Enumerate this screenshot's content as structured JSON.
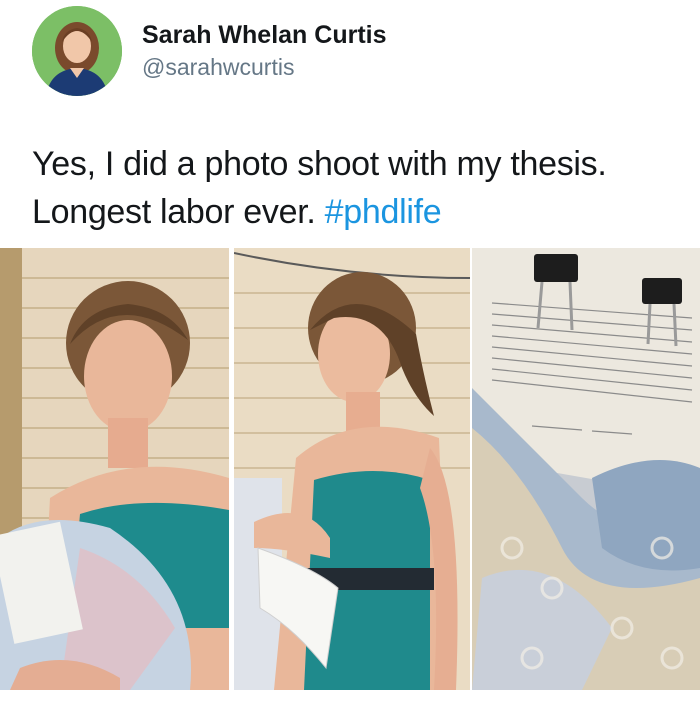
{
  "author": {
    "display_name": "Sarah Whelan Curtis",
    "handle": "@sarahwcurtis"
  },
  "tweet": {
    "text_line1": "Yes, I did a photo shoot with my thesis.",
    "text_line2": "Longest labor ever. ",
    "hashtag": "#phdlife"
  },
  "colors": {
    "hashtag": "#1b95e0",
    "dress": "#1f8a8c",
    "handle": "#657786"
  },
  "icons": {
    "avatar": "profile-photo"
  }
}
